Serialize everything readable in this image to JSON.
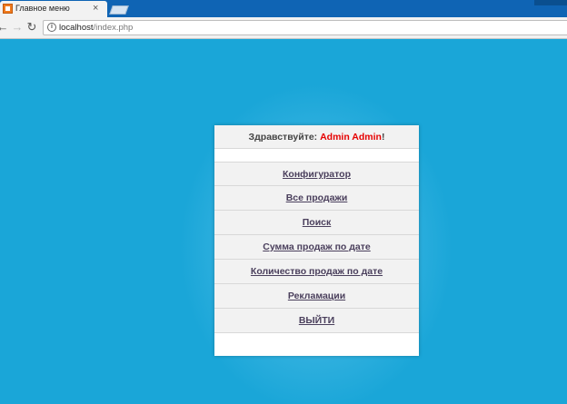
{
  "browser": {
    "tab_title": "Главное меню",
    "tab_close": "×",
    "url_host": "localhost",
    "url_path": "/index.php"
  },
  "panel": {
    "greeting_prefix": "Здравствуйте: ",
    "user_name": "Admin Admin",
    "greeting_suffix": "!",
    "menu": [
      {
        "label": "Конфигуратор"
      },
      {
        "label": "Все продажи"
      },
      {
        "label": "Поиск"
      },
      {
        "label": "Сумма продаж по дате"
      },
      {
        "label": "Количество продаж по дате"
      },
      {
        "label": "Рекламации"
      },
      {
        "label": "ВЫЙТИ"
      }
    ]
  },
  "colors": {
    "background": "#1aa6d8",
    "user_name": "#e60000",
    "link": "#4a3f5c"
  }
}
